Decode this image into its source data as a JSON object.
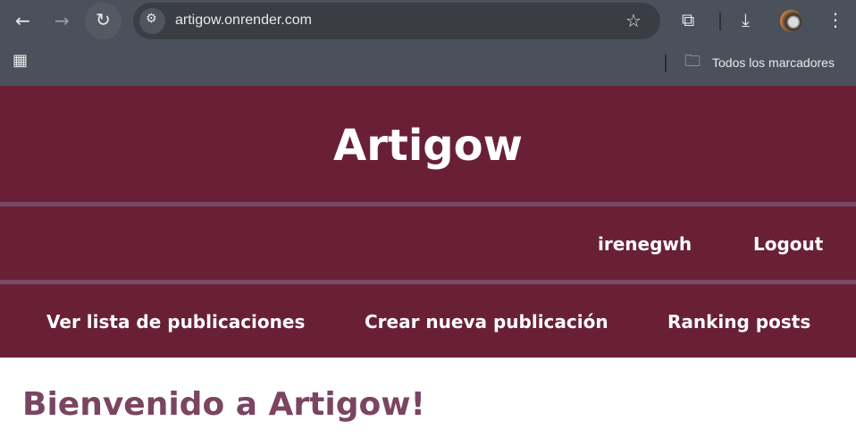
{
  "browser": {
    "url": "artigow.onrender.com",
    "bookmarks_label": "Todos los marcadores",
    "icons": [
      "back-icon",
      "forward-icon",
      "reload-icon",
      "site-settings-icon",
      "star-icon",
      "extensions-icon",
      "download-icon",
      "avatar",
      "menu-icon",
      "apps-icon",
      "folder-icon"
    ]
  },
  "site": {
    "title": "Artigow",
    "user": "irenegwh",
    "logout": "Logout",
    "nav": [
      {
        "label": "Ver lista de publicaciones"
      },
      {
        "label": "Crear nueva publicación"
      },
      {
        "label": "Ranking posts"
      }
    ],
    "welcome": "Bienvenido a Artigow!"
  },
  "colors": {
    "header": "#692036",
    "separator": "#7a4a64",
    "welcome": "#7a4562",
    "browser": "#4b515b"
  }
}
